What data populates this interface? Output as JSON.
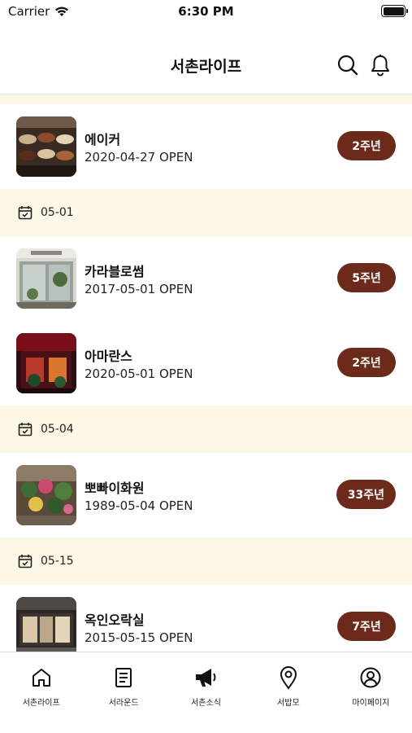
{
  "status_bar": {
    "carrier": "Carrier",
    "time": "6:30 PM"
  },
  "header": {
    "title": "서촌라이프"
  },
  "sections": [
    {
      "items": [
        {
          "name": "에이커",
          "open": "2020-04-27 OPEN",
          "badge": "2주년",
          "thumb": "cake-display"
        }
      ]
    },
    {
      "date": "05-01",
      "items": [
        {
          "name": "카라블로썸",
          "open": "2017-05-01 OPEN",
          "badge": "5주년",
          "thumb": "flower-shop-front"
        },
        {
          "name": "아마란스",
          "open": "2020-05-01 OPEN",
          "badge": "2주년",
          "thumb": "red-lit-shop"
        }
      ]
    },
    {
      "date": "05-04",
      "items": [
        {
          "name": "뽀빠이화원",
          "open": "1989-05-04 OPEN",
          "badge": "33주년",
          "thumb": "flower-stand"
        }
      ]
    },
    {
      "date": "05-15",
      "items": [
        {
          "name": "옥인오락실",
          "open": "2015-05-15 OPEN",
          "badge": "7주년",
          "thumb": "arcade-front"
        }
      ]
    }
  ],
  "tabbar": [
    {
      "label": "서촌라이프",
      "icon": "home-icon"
    },
    {
      "label": "서라운드",
      "icon": "document-icon"
    },
    {
      "label": "서촌소식",
      "icon": "megaphone-icon"
    },
    {
      "label": "서밥모",
      "icon": "map-pin-icon"
    },
    {
      "label": "마이페이지",
      "icon": "user-circle-icon"
    }
  ],
  "colors": {
    "badge": "#6b2a1a",
    "date_band": "#fdf8e6",
    "text": "#111111"
  }
}
